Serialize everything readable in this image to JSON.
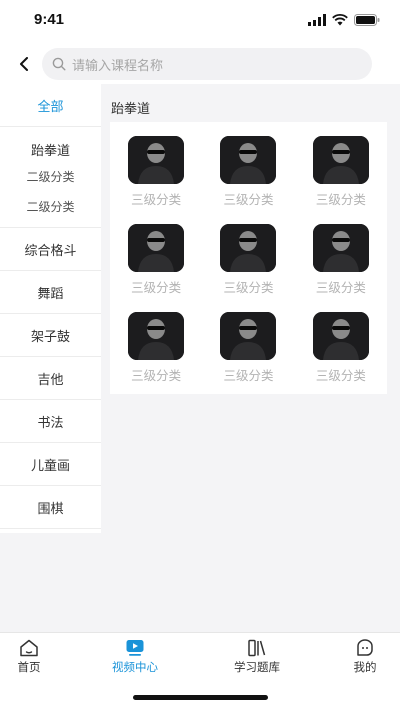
{
  "status_bar": {
    "time": "9:41",
    "icons": [
      "signal-icon",
      "wifi-icon",
      "battery-icon"
    ]
  },
  "search": {
    "placeholder": "请输入课程名称",
    "icon": "search-icon",
    "back_icon": "chevron-left-icon"
  },
  "sidebar": {
    "items": [
      {
        "label": "全部",
        "active": true
      },
      {
        "label": "跆拳道",
        "subitems": [
          "二级分类",
          "二级分类"
        ]
      },
      {
        "label": "综合格斗"
      },
      {
        "label": "舞蹈"
      },
      {
        "label": "架子鼓"
      },
      {
        "label": "吉他"
      },
      {
        "label": "书法"
      },
      {
        "label": "儿童画"
      },
      {
        "label": "围棋"
      }
    ]
  },
  "content": {
    "section_title": "跆拳道",
    "items": [
      "三级分类",
      "三级分类",
      "三级分类",
      "三级分类",
      "三级分类",
      "三级分类",
      "三级分类",
      "三级分类",
      "三级分类"
    ]
  },
  "tab_bar": {
    "tabs": [
      {
        "label": "首页",
        "icon": "home-icon",
        "active": false
      },
      {
        "label": "视频中心",
        "icon": "video-icon",
        "active": true
      },
      {
        "label": "学习题库",
        "icon": "books-icon",
        "active": false
      },
      {
        "label": "我的",
        "icon": "profile-icon",
        "active": false
      }
    ]
  },
  "colors": {
    "accent": "#1a93d8",
    "background": "#f4f4f6"
  }
}
